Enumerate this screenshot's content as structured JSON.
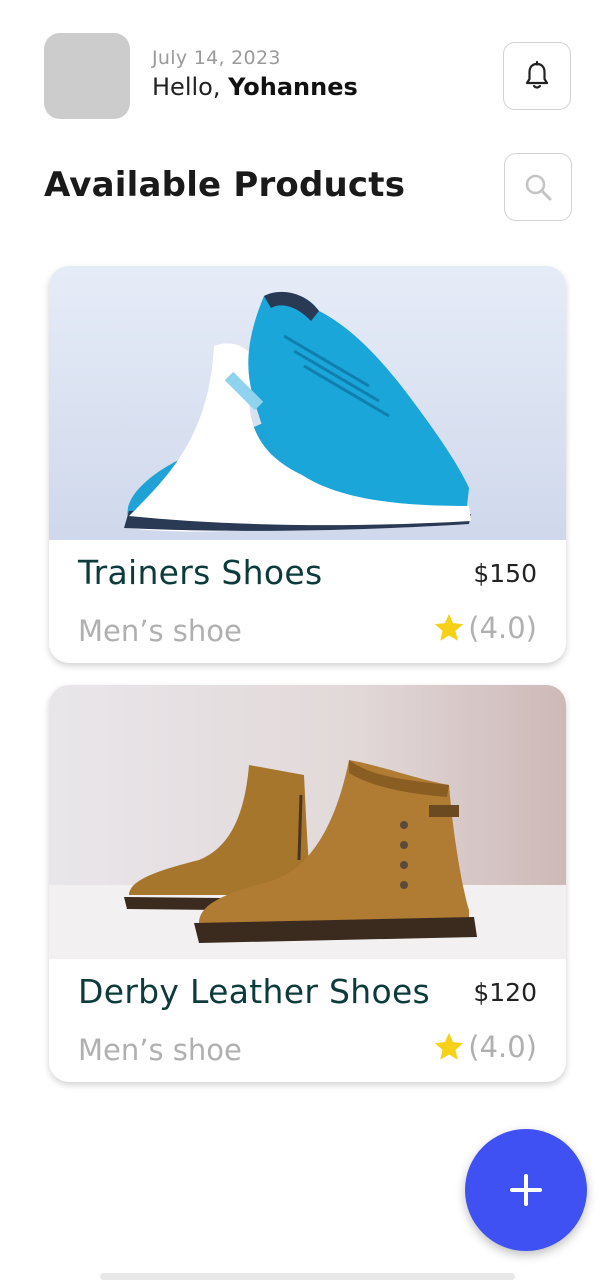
{
  "header": {
    "date": "July 14, 2023",
    "greeting": "Hello,",
    "user_name": "Yohannes",
    "notification_icon": "bell-icon"
  },
  "page": {
    "title": "Available Products",
    "search_icon": "search-icon"
  },
  "products": [
    {
      "name": "Trainers Shoes",
      "price": "$150",
      "category": "Men’s shoe",
      "rating": "(4.0)",
      "image": "blue-sneakers-photo"
    },
    {
      "name": "Derby Leather Shoes",
      "price": "$120",
      "category": "Men’s shoe",
      "rating": "(4.0)",
      "image": "brown-leather-boots-photo"
    }
  ],
  "fab": {
    "icon": "plus-icon"
  },
  "colors": {
    "accent": "#3f51f2",
    "product_name": "#0d3b3b",
    "star": "#f7d117",
    "muted": "#b0b0b0"
  }
}
